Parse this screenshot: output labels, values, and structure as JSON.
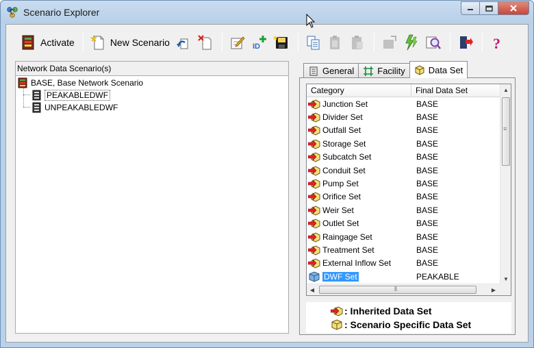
{
  "window": {
    "title": "Scenario Explorer"
  },
  "toolbar": {
    "activate_label": "Activate",
    "new_scenario_label": "New Scenario"
  },
  "left": {
    "header": "Network Data Scenario(s)",
    "tree": [
      {
        "label": "BASE, Base Network Scenario",
        "level": 0
      },
      {
        "label": "PEAKABLEDWF",
        "level": 1,
        "selected": true
      },
      {
        "label": "UNPEAKABLEDWF",
        "level": 1
      }
    ]
  },
  "right": {
    "tabs": [
      {
        "label": "General",
        "icon": "document-icon"
      },
      {
        "label": "Facility",
        "icon": "network-icon"
      },
      {
        "label": "Data Set",
        "icon": "box-icon",
        "active": true
      }
    ],
    "columns": [
      "Category",
      "Final Data Set"
    ],
    "rows": [
      {
        "category": "Junction Set",
        "value": "BASE",
        "type": "inherited"
      },
      {
        "category": "Divider Set",
        "value": "BASE",
        "type": "inherited"
      },
      {
        "category": "Outfall Set",
        "value": "BASE",
        "type": "inherited"
      },
      {
        "category": "Storage Set",
        "value": "BASE",
        "type": "inherited"
      },
      {
        "category": "Subcatch Set",
        "value": "BASE",
        "type": "inherited"
      },
      {
        "category": "Conduit Set",
        "value": "BASE",
        "type": "inherited"
      },
      {
        "category": "Pump Set",
        "value": "BASE",
        "type": "inherited"
      },
      {
        "category": "Orifice Set",
        "value": "BASE",
        "type": "inherited"
      },
      {
        "category": "Weir Set",
        "value": "BASE",
        "type": "inherited"
      },
      {
        "category": "Outlet Set",
        "value": "BASE",
        "type": "inherited"
      },
      {
        "category": "Raingage Set",
        "value": "BASE",
        "type": "inherited"
      },
      {
        "category": "Treatment Set",
        "value": "BASE",
        "type": "inherited"
      },
      {
        "category": "External Inflow Set",
        "value": "BASE",
        "type": "inherited"
      },
      {
        "category": "DWF Set",
        "value": "PEAKABLE",
        "type": "specific",
        "selected": true
      }
    ],
    "legend": {
      "inherited": ": Inherited Data Set",
      "specific": ": Scenario Specific Data Set"
    }
  },
  "colors": {
    "selection": "#3399ff",
    "title_bar": "#b9d1ea",
    "close_button": "#c7463a"
  }
}
